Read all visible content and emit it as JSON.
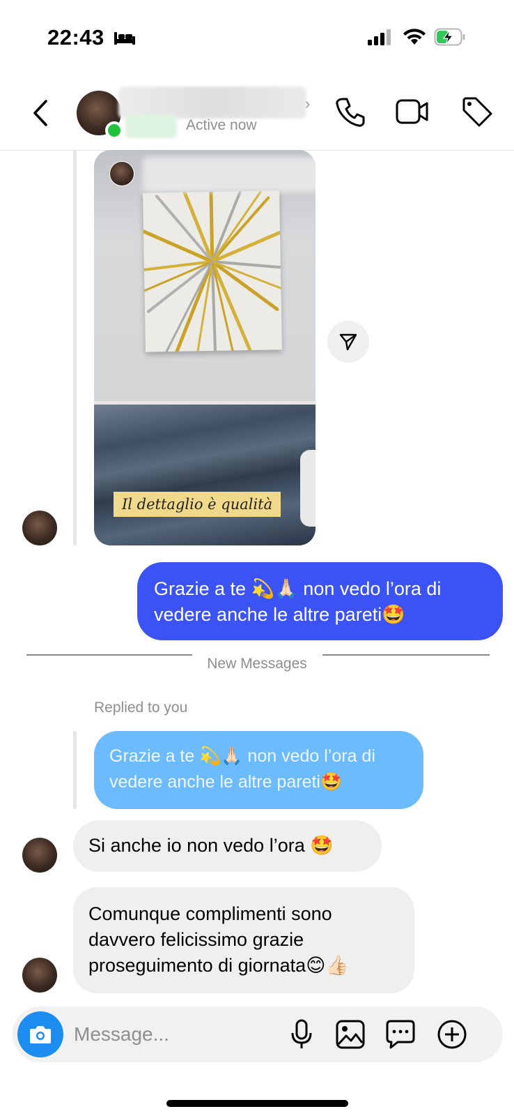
{
  "status_bar": {
    "time": "22:43",
    "icons": [
      "sleep-focus-icon",
      "cellular-signal-icon",
      "wifi-icon",
      "battery-charging-icon"
    ],
    "battery_color": "#34c759"
  },
  "header": {
    "active_status": "Active now",
    "icons": [
      "back-icon",
      "phone-icon",
      "video-icon",
      "tag-icon"
    ]
  },
  "shared_post": {
    "caption": "Il dettaglio è qualità",
    "share_icon": "send-icon"
  },
  "messages": {
    "outgoing_1": {
      "line1": "Grazie a te 💫🙏🏻 non vedo l’ora di",
      "line2": "vedere anche le altre pareti🤩"
    },
    "new_messages_label": "New Messages",
    "replied_label": "Replied to you",
    "reply_quote": {
      "line1": "Grazie a te 💫🙏🏻 non vedo l’ora di",
      "line2": "vedere anche le altre pareti🤩"
    },
    "incoming_1": "Si anche io non vedo l’ora 🤩",
    "incoming_2": {
      "line1": "Comunque complimenti sono",
      "line2": "davvero felicissimo grazie",
      "line3": "proseguimento di giornata😊👍🏻"
    }
  },
  "composer": {
    "placeholder": "Message...",
    "icons": [
      "camera-icon",
      "microphone-icon",
      "gallery-icon",
      "sticker-icon",
      "plus-icon"
    ]
  },
  "colors": {
    "outgoing_bubble": "#3b53f5",
    "reply_quote_bubble": "#6dbbff",
    "incoming_bubble": "#efefef",
    "camera_button": "#1d8cf0",
    "online_dot": "#22c33c"
  }
}
